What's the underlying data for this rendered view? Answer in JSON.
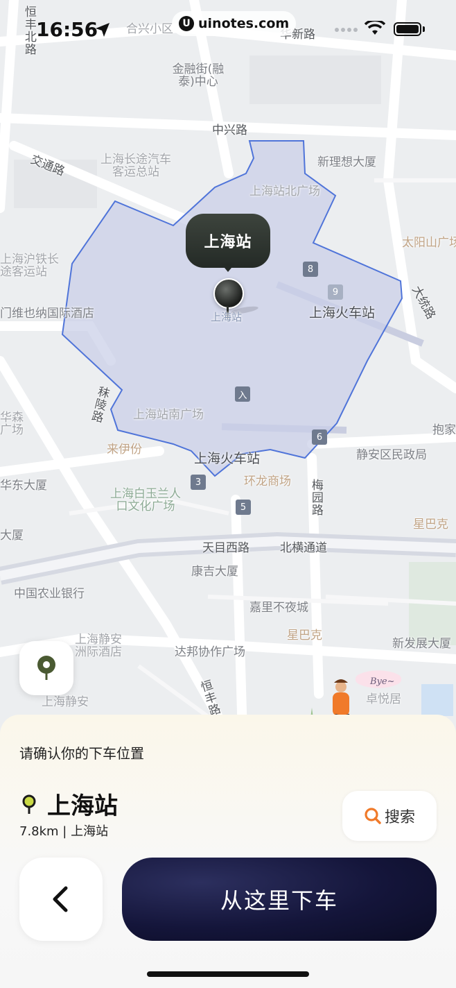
{
  "status_bar": {
    "time": "16:56",
    "watermark": "uinotes.com"
  },
  "map": {
    "selected_marker": {
      "title": "上海站",
      "label": "上海站"
    },
    "labels": {
      "hengfeng_north": "恒丰北路",
      "hexing": "合兴小区",
      "huaxin": "华新路",
      "jinrongjie": "金融街(融泰)中心",
      "zhongxing": "中兴路",
      "jiaotong": "交通路",
      "longdistance": "上海长途汽车客运总站",
      "xinlixiang": "新理想大厦",
      "north_square": "上海站北广场",
      "taiyangshan": "太阳山广场",
      "hu_railway": "上海沪铁长途客运站",
      "vienna": "维也纳国际酒店",
      "vienna_prefix": "门",
      "dalian": "大统路",
      "train_station_east": "上海火车站",
      "molin": "秣陵路",
      "huasen": "华森广场",
      "south_square": "上海站南广场",
      "laiyifen": "来伊份",
      "train_station_south": "上海火车站",
      "jingan_gov": "静安区民政局",
      "baojia": "抱家",
      "huadong": "华东大厦",
      "huanlong": "环龙商场",
      "meiyuan": "梅园路",
      "baiyulan": "上海白玉兰人口文化广场",
      "starbucks_right": "星巴克",
      "dasha": "大厦",
      "tianmu": "天目西路",
      "beiheng": "北横通道",
      "kangji": "康吉大厦",
      "abc_bank": "中国农业银行",
      "jiali": "嘉里不夜城",
      "jingan_hotel": "上海静安洲际酒店",
      "starbucks": "星巴克",
      "xinfazhan": "新发展大厦",
      "dabang": "达邦协作广场",
      "bye_sign": "Bye~",
      "zhuoyue": "卓悦居",
      "hengfeng": "恒丰路",
      "jingan_bottom": "上海静安"
    },
    "gates": [
      "8",
      "9",
      "入",
      "6",
      "3",
      "5"
    ]
  },
  "sheet": {
    "prompt": "请确认你的下车位置",
    "place_name": "上海站",
    "place_detail": "7.8km | 上海站",
    "search_label": "搜索",
    "confirm_label": "从这里下车"
  },
  "colors": {
    "accent_dark": "#14153a",
    "area_fill": "#c9cfe8",
    "area_stroke": "#4f74d9",
    "search_icon": "#f07a2a"
  }
}
